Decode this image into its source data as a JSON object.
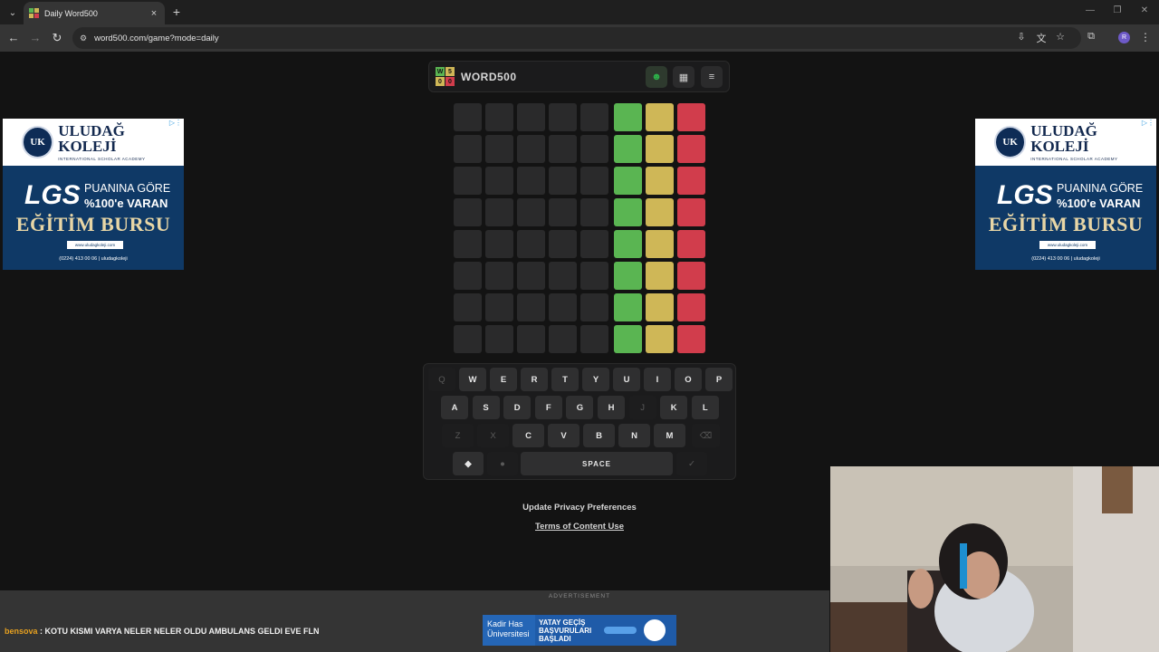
{
  "browser": {
    "tab_title": "Daily Word500",
    "url": "word500.com/game?mode=daily",
    "profile_initial": "R"
  },
  "game": {
    "logo_letters": [
      "W",
      "5",
      "0",
      "0"
    ],
    "title": "WORD500",
    "rows": 8,
    "letters_per_row": 5,
    "row_counts": [
      {
        "green": null,
        "yellow": null,
        "red": null
      },
      {
        "green": null,
        "yellow": null,
        "red": null
      },
      {
        "green": null,
        "yellow": null,
        "red": null
      },
      {
        "green": null,
        "yellow": null,
        "red": null
      },
      {
        "green": null,
        "yellow": null,
        "red": null
      },
      {
        "green": null,
        "yellow": null,
        "red": null
      },
      {
        "green": null,
        "yellow": null,
        "red": null
      },
      {
        "green": null,
        "yellow": null,
        "red": null
      }
    ],
    "colors": {
      "green": "#5ab552",
      "yellow": "#cfb757",
      "red": "#d13d4c"
    }
  },
  "keyboard": {
    "row1": [
      "Q",
      "W",
      "E",
      "R",
      "T",
      "Y",
      "U",
      "I",
      "O",
      "P"
    ],
    "row2": [
      "A",
      "S",
      "D",
      "F",
      "G",
      "H",
      "J",
      "K",
      "L"
    ],
    "row3": [
      "Z",
      "X",
      "C",
      "V",
      "B",
      "N",
      "M"
    ],
    "disabled": [
      "Q",
      "J",
      "Z",
      "X"
    ],
    "space_label": "SPACE"
  },
  "links": {
    "privacy": "Update Privacy Preferences",
    "terms": "Terms of Content Use"
  },
  "side_ad": {
    "emblem": "UK",
    "brand": "ULUDAĞ KOLEJİ",
    "brand_sub": "INTERNATIONAL SCHOLAR ACADEMY",
    "lgs": "LGS",
    "line1": "PUANINA GÖRE",
    "line2": "%100'e VARAN",
    "headline": "EĞİTİM BURSU",
    "web": "www.uludagkoleji.com",
    "contact": "(0224) 413 00 06 | uludagkoleji"
  },
  "overlay": {
    "ad_label": "ADVERTISEMENT",
    "chat_user": "bensova",
    "chat_message": " : KOTU KISMI VARYA NELER NELER OLDU AMBULANS GELDI EVE FLN",
    "bottom_ad_left": "Kadir Has Üniversitesi",
    "bottom_ad_text": "YATAY GEÇİŞ BAŞVURULARI BAŞLADI"
  }
}
